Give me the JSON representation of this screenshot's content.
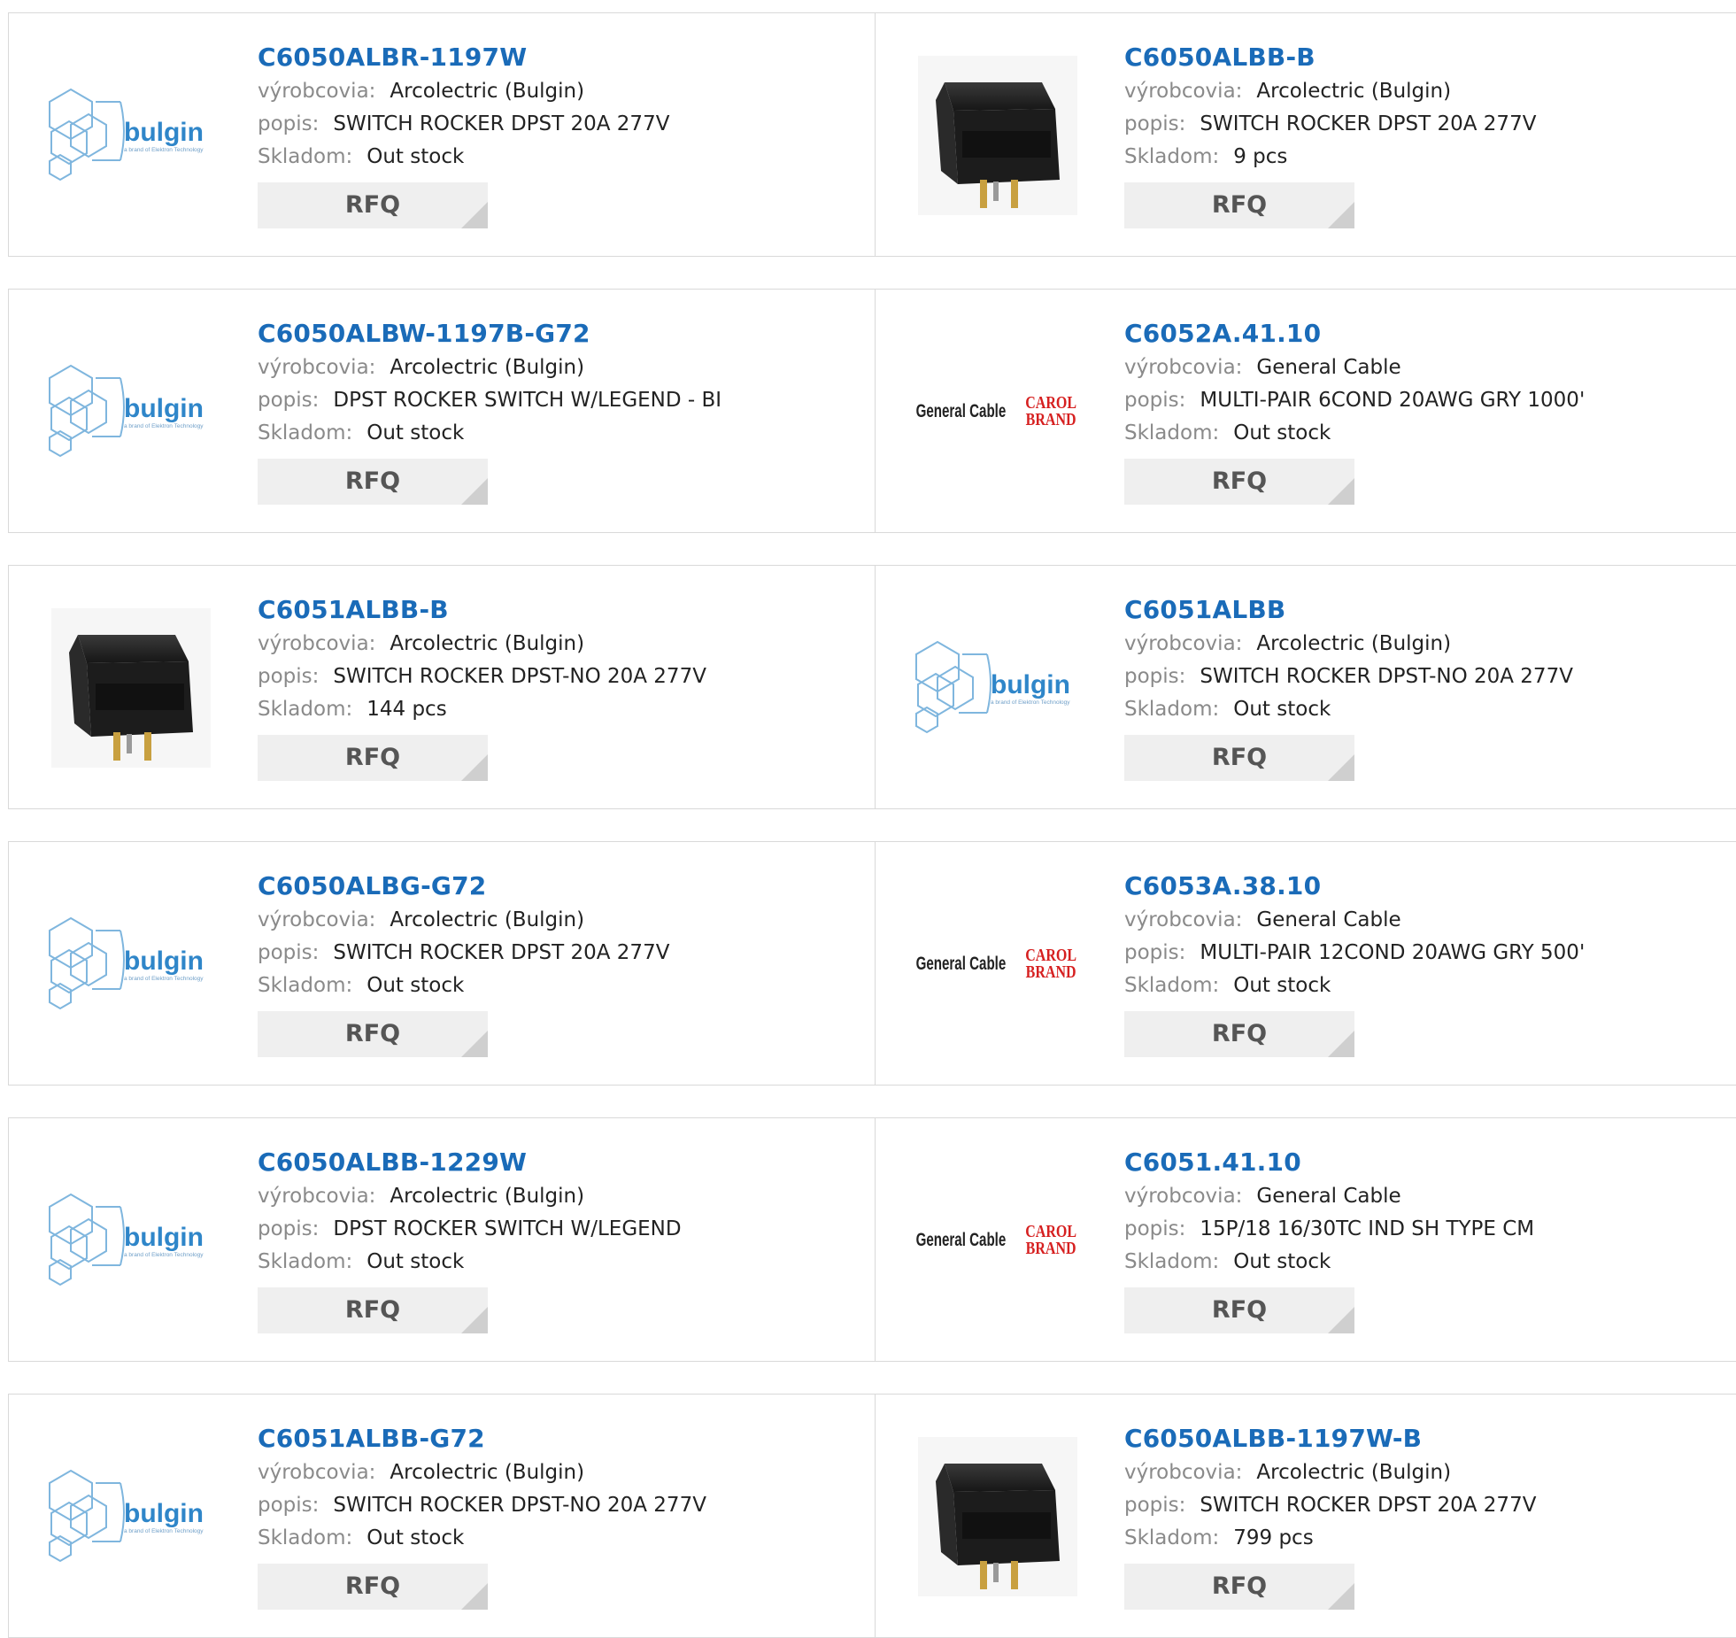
{
  "labels": {
    "manufacturer": "výrobcovia:",
    "description": "popis:",
    "stock": "Skladom:",
    "rfq": "RFQ"
  },
  "logos": {
    "bulgin_word": "bulgin",
    "bulgin_tag": "a brand of Elektron Technology",
    "general_cable": "General Cable",
    "carol_top": "CAROL",
    "carol_bottom": "BRAND"
  },
  "colors": {
    "link": "#1a6bb8",
    "label": "#8a8a8a",
    "bulgin_blue": "#2f86c9",
    "carol_red": "#d62020"
  },
  "products": [
    {
      "pn": "C6050ALBR-1197W",
      "mfr": "Arcolectric (Bulgin)",
      "desc": "SWITCH ROCKER DPST 20A 277V",
      "stock": "Out stock",
      "image": "bulgin-logo"
    },
    {
      "pn": "C6050ALBB-B",
      "mfr": "Arcolectric (Bulgin)",
      "desc": "SWITCH ROCKER DPST 20A 277V",
      "stock": "9 pcs",
      "image": "rocker-switch-photo"
    },
    {
      "pn": "C6050ALBW-1197B-G72",
      "mfr": "Arcolectric (Bulgin)",
      "desc": "DPST ROCKER SWITCH W/LEGEND - BI",
      "stock": "Out stock",
      "image": "bulgin-logo"
    },
    {
      "pn": "C6052A.41.10",
      "mfr": "General Cable",
      "desc": "MULTI-PAIR 6COND 20AWG GRY 1000'",
      "stock": "Out stock",
      "image": "general-cable-logo"
    },
    {
      "pn": "C6051ALBB-B",
      "mfr": "Arcolectric (Bulgin)",
      "desc": "SWITCH ROCKER DPST-NO 20A 277V",
      "stock": "144 pcs",
      "image": "rocker-switch-photo"
    },
    {
      "pn": "C6051ALBB",
      "mfr": "Arcolectric (Bulgin)",
      "desc": "SWITCH ROCKER DPST-NO 20A 277V",
      "stock": "Out stock",
      "image": "bulgin-logo"
    },
    {
      "pn": "C6050ALBG-G72",
      "mfr": "Arcolectric (Bulgin)",
      "desc": "SWITCH ROCKER DPST 20A 277V",
      "stock": "Out stock",
      "image": "bulgin-logo"
    },
    {
      "pn": "C6053A.38.10",
      "mfr": "General Cable",
      "desc": "MULTI-PAIR 12COND 20AWG GRY 500'",
      "stock": "Out stock",
      "image": "general-cable-logo"
    },
    {
      "pn": "C6050ALBB-1229W",
      "mfr": "Arcolectric (Bulgin)",
      "desc": "DPST ROCKER SWITCH W/LEGEND",
      "stock": "Out stock",
      "image": "bulgin-logo"
    },
    {
      "pn": "C6051.41.10",
      "mfr": "General Cable",
      "desc": "15P/18 16/30TC IND SH TYPE CM",
      "stock": "Out stock",
      "image": "general-cable-logo"
    },
    {
      "pn": "C6051ALBB-G72",
      "mfr": "Arcolectric (Bulgin)",
      "desc": "SWITCH ROCKER DPST-NO 20A 277V",
      "stock": "Out stock",
      "image": "bulgin-logo"
    },
    {
      "pn": "C6050ALBB-1197W-B",
      "mfr": "Arcolectric (Bulgin)",
      "desc": "SWITCH ROCKER DPST 20A 277V",
      "stock": "799 pcs",
      "image": "rocker-switch-photo"
    }
  ]
}
